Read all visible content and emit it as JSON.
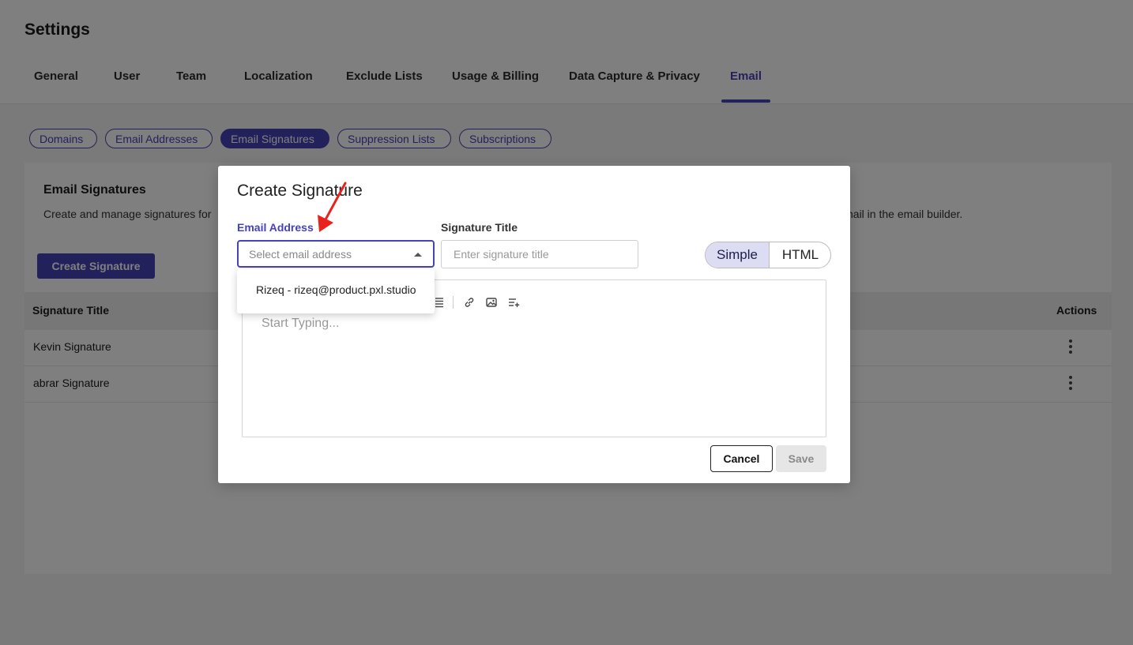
{
  "page": {
    "title": "Settings"
  },
  "tabs": [
    {
      "label": "General"
    },
    {
      "label": "User"
    },
    {
      "label": "Team"
    },
    {
      "label": "Localization"
    },
    {
      "label": "Exclude Lists"
    },
    {
      "label": "Usage & Billing"
    },
    {
      "label": "Data Capture & Privacy"
    },
    {
      "label": "Email",
      "active": true
    }
  ],
  "subtabs": [
    {
      "label": "Domains"
    },
    {
      "label": "Email Addresses"
    },
    {
      "label": "Email Signatures",
      "active": true
    },
    {
      "label": "Suppression Lists"
    },
    {
      "label": "Subscriptions"
    }
  ],
  "card": {
    "title": "Email Signatures",
    "description": "Create and manage signatures for",
    "description_tail": "nail in the email builder.",
    "create_button": "Create Signature",
    "columns": {
      "title": "Signature Title",
      "actions": "Actions"
    },
    "rows": [
      {
        "title": "Kevin Signature"
      },
      {
        "title": "abrar Signature"
      }
    ]
  },
  "modal": {
    "title": "Create Signature",
    "email_label": "Email Address",
    "email_placeholder": "Select email address",
    "title_label": "Signature Title",
    "title_placeholder": "Enter signature title",
    "mode_simple": "Simple",
    "mode_html": "HTML",
    "active_mode": "Simple",
    "editor_placeholder": "Start Typing...",
    "cancel": "Cancel",
    "save": "Save",
    "dropdown_options": [
      "Rizeq - rizeq@product.pxl.studio"
    ]
  },
  "colors": {
    "accent": "#4642b8",
    "annotation_arrow": "#e8231d"
  },
  "icons": [
    "list-icon",
    "link-icon",
    "image-icon",
    "insert-field-icon",
    "kebab-menu-icon",
    "caret-up-icon",
    "annotation-arrow"
  ]
}
